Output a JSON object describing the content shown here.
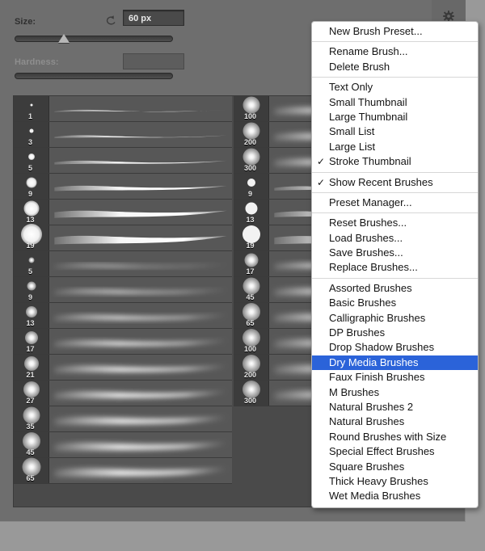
{
  "app": {
    "title": "Brush Preset Picker",
    "accent_selected": "#2b63d9",
    "panel_bg": "#6e6e6e",
    "list_bg": "#4a4a4a"
  },
  "controls": {
    "size": {
      "label": "Size:",
      "value": "60 px",
      "reset_icon": "reset-arrow-icon",
      "slider_percent": 31
    },
    "hardness": {
      "label": "Hardness:",
      "value": "",
      "slider_percent": 0,
      "disabled": true
    },
    "gear_icon": "gear-icon"
  },
  "brush_list": {
    "columns": [
      {
        "name": "column-left",
        "items": [
          {
            "size": "1",
            "dot": 1.5,
            "soft": 0.0,
            "stroke": "hairline"
          },
          {
            "size": "3",
            "dot": 2.5,
            "soft": 0.0,
            "stroke": "thin"
          },
          {
            "size": "5",
            "dot": 4.0,
            "soft": 0.1,
            "stroke": "thin2"
          },
          {
            "size": "9",
            "dot": 6.5,
            "soft": 0.1,
            "stroke": "med"
          },
          {
            "size": "13",
            "dot": 9.5,
            "soft": 0.1,
            "stroke": "med2"
          },
          {
            "size": "19",
            "dot": 13.0,
            "soft": 0.1,
            "stroke": "thick"
          },
          {
            "size": "5",
            "dot": 3.5,
            "soft": 0.6,
            "stroke": "soft-thin"
          },
          {
            "size": "9",
            "dot": 5.5,
            "soft": 0.6,
            "stroke": "soft-med"
          },
          {
            "size": "13",
            "dot": 7.0,
            "soft": 0.6,
            "stroke": "soft-med2"
          },
          {
            "size": "17",
            "dot": 8.0,
            "soft": 0.6,
            "stroke": "soft-med3"
          },
          {
            "size": "21",
            "dot": 9.0,
            "soft": 0.6,
            "stroke": "soft-thick"
          },
          {
            "size": "27",
            "dot": 10.0,
            "soft": 0.6,
            "stroke": "soft-thick2"
          },
          {
            "size": "35",
            "dot": 10.5,
            "soft": 0.7,
            "stroke": "soft-thick3"
          },
          {
            "size": "45",
            "dot": 11.0,
            "soft": 0.7,
            "stroke": "soft-thick4"
          },
          {
            "size": "65",
            "dot": 11.5,
            "soft": 0.7,
            "stroke": "soft-thick5"
          }
        ]
      },
      {
        "name": "column-right",
        "items": [
          {
            "size": "100",
            "dot": 10.5,
            "soft": 0.65,
            "stroke": "big-soft"
          },
          {
            "size": "200",
            "dot": 10.5,
            "soft": 0.65,
            "stroke": "big-soft2"
          },
          {
            "size": "300",
            "dot": 10.5,
            "soft": 0.65,
            "stroke": "big-soft3"
          },
          {
            "size": "9",
            "dot": 5.0,
            "soft": 0.0,
            "stroke": "flat-med"
          },
          {
            "size": "13",
            "dot": 7.5,
            "soft": 0.0,
            "stroke": "flat-thick"
          },
          {
            "size": "19",
            "dot": 11.0,
            "soft": 0.0,
            "stroke": "flat-thick2"
          },
          {
            "size": "17",
            "dot": 8.5,
            "soft": 0.6,
            "stroke": "blur-med"
          },
          {
            "size": "45",
            "dot": 10.5,
            "soft": 0.7,
            "stroke": "blur-thick"
          },
          {
            "size": "65",
            "dot": 11.0,
            "soft": 0.7,
            "stroke": "blur-thick2"
          },
          {
            "size": "100",
            "dot": 11.0,
            "soft": 0.75,
            "stroke": "blur-thick3"
          },
          {
            "size": "200",
            "dot": 11.0,
            "soft": 0.75,
            "stroke": "blur-thick4"
          },
          {
            "size": "300",
            "dot": 11.0,
            "soft": 0.75,
            "stroke": "blur-thick5"
          }
        ]
      }
    ]
  },
  "menu": {
    "name": "brush-preset-flyout-menu",
    "groups": [
      {
        "items": [
          {
            "label": "New Brush Preset...",
            "checked": false,
            "selected": false
          }
        ]
      },
      {
        "items": [
          {
            "label": "Rename Brush...",
            "checked": false,
            "selected": false
          },
          {
            "label": "Delete Brush",
            "checked": false,
            "selected": false
          }
        ]
      },
      {
        "items": [
          {
            "label": "Text Only",
            "checked": false,
            "selected": false
          },
          {
            "label": "Small Thumbnail",
            "checked": false,
            "selected": false
          },
          {
            "label": "Large Thumbnail",
            "checked": false,
            "selected": false
          },
          {
            "label": "Small List",
            "checked": false,
            "selected": false
          },
          {
            "label": "Large List",
            "checked": false,
            "selected": false
          },
          {
            "label": "Stroke Thumbnail",
            "checked": true,
            "selected": false
          }
        ]
      },
      {
        "items": [
          {
            "label": "Show Recent Brushes",
            "checked": true,
            "selected": false
          }
        ]
      },
      {
        "items": [
          {
            "label": "Preset Manager...",
            "checked": false,
            "selected": false
          }
        ]
      },
      {
        "items": [
          {
            "label": "Reset Brushes...",
            "checked": false,
            "selected": false
          },
          {
            "label": "Load Brushes...",
            "checked": false,
            "selected": false
          },
          {
            "label": "Save Brushes...",
            "checked": false,
            "selected": false
          },
          {
            "label": "Replace Brushes...",
            "checked": false,
            "selected": false
          }
        ]
      },
      {
        "items": [
          {
            "label": "Assorted Brushes",
            "checked": false,
            "selected": false
          },
          {
            "label": "Basic Brushes",
            "checked": false,
            "selected": false
          },
          {
            "label": "Calligraphic Brushes",
            "checked": false,
            "selected": false
          },
          {
            "label": "DP Brushes",
            "checked": false,
            "selected": false
          },
          {
            "label": "Drop Shadow Brushes",
            "checked": false,
            "selected": false
          },
          {
            "label": "Dry Media Brushes",
            "checked": false,
            "selected": true
          },
          {
            "label": "Faux Finish Brushes",
            "checked": false,
            "selected": false
          },
          {
            "label": "M Brushes",
            "checked": false,
            "selected": false
          },
          {
            "label": "Natural Brushes 2",
            "checked": false,
            "selected": false
          },
          {
            "label": "Natural Brushes",
            "checked": false,
            "selected": false
          },
          {
            "label": "Round Brushes with Size",
            "checked": false,
            "selected": false
          },
          {
            "label": "Special Effect Brushes",
            "checked": false,
            "selected": false
          },
          {
            "label": "Square Brushes",
            "checked": false,
            "selected": false
          },
          {
            "label": "Thick Heavy Brushes",
            "checked": false,
            "selected": false
          },
          {
            "label": "Wet Media Brushes",
            "checked": false,
            "selected": false
          }
        ]
      }
    ]
  }
}
